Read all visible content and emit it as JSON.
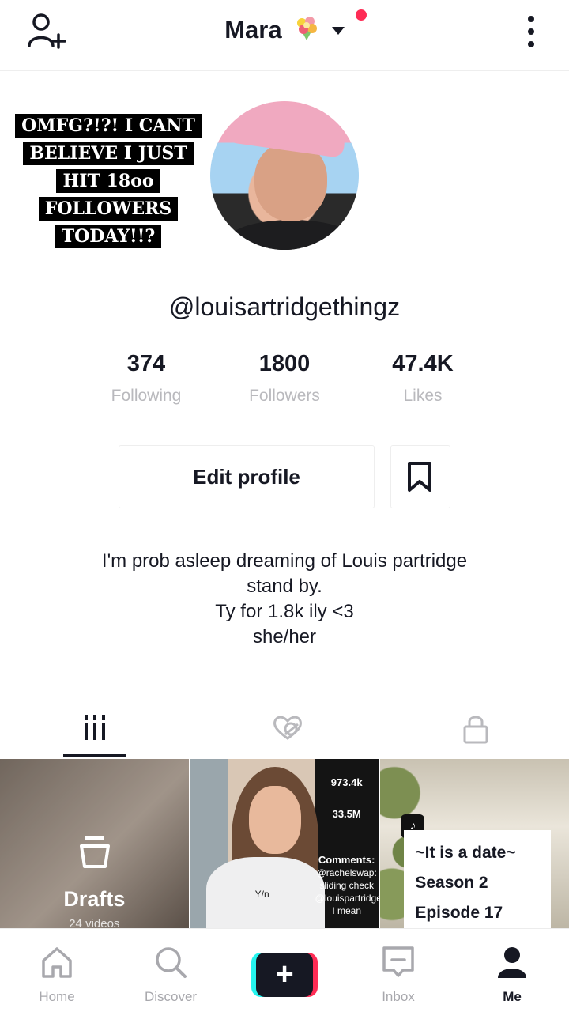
{
  "header": {
    "title": "Mara",
    "emoji": "💐",
    "add_user_icon": "add-user-icon",
    "more_icon": "more-vertical-icon",
    "notification_color": "#fe2c55"
  },
  "profile": {
    "sticker_lines": [
      "OMFG?!?! I CANT",
      "BELIEVE I JUST",
      "HIT 18oo",
      "FOLLOWERS",
      "TODAY!!?"
    ],
    "username": "@louisartridgethingz",
    "stats": [
      {
        "value": "374",
        "label": "Following"
      },
      {
        "value": "1800",
        "label": "Followers"
      },
      {
        "value": "47.4K",
        "label": "Likes"
      }
    ],
    "edit_button": "Edit profile",
    "bio_lines": [
      "I'm prob asleep dreaming of Louis partridge",
      "stand by.",
      "Ty for 1.8k ily <3",
      "she/her"
    ]
  },
  "tabs": [
    {
      "name": "videos",
      "icon": "grid-icon",
      "active": true
    },
    {
      "name": "liked",
      "icon": "liked-hidden-icon",
      "active": false
    },
    {
      "name": "private",
      "icon": "lock-icon",
      "active": false
    }
  ],
  "grid": {
    "drafts_label": "Drafts",
    "drafts_count": "24 videos",
    "video2": {
      "stats": [
        "973.4k",
        "33.5M"
      ],
      "comments_title": "Comments:",
      "comments": [
        "@rachelswap:",
        "sliding check",
        "@louispartridge:",
        "I mean"
      ],
      "caption": "Y/n"
    },
    "video3": {
      "lines": [
        "~It is a date~",
        "Season 2",
        "Episode 17"
      ]
    }
  },
  "bottom_nav": [
    {
      "label": "Home",
      "icon": "home-icon"
    },
    {
      "label": "Discover",
      "icon": "search-icon"
    },
    {
      "label": "",
      "icon": "create-plus-icon"
    },
    {
      "label": "Inbox",
      "icon": "inbox-icon"
    },
    {
      "label": "Me",
      "icon": "profile-icon",
      "active": true
    }
  ]
}
